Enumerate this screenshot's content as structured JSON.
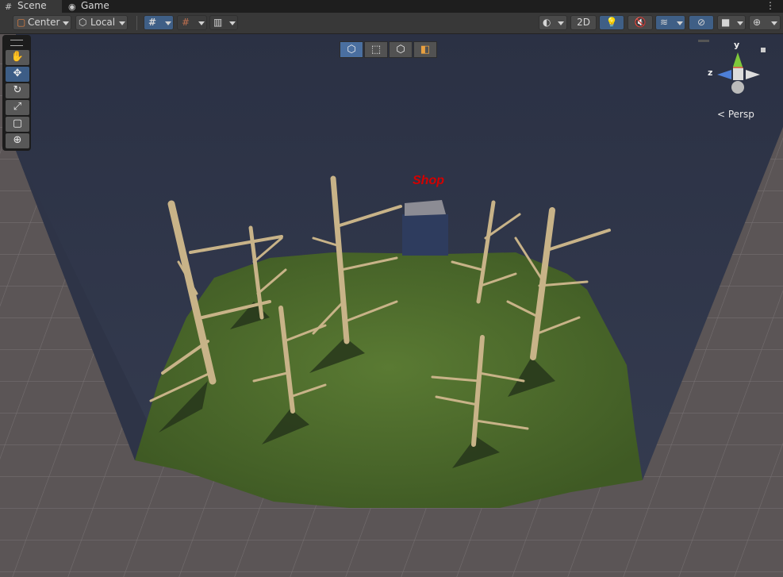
{
  "tabs": [
    {
      "label": "Scene",
      "icon": "grid-icon",
      "active": true
    },
    {
      "label": "Game",
      "icon": "gamepad-icon",
      "active": false
    }
  ],
  "toolbar": {
    "pivot_mode": "Center",
    "pivot_rotation": "Local",
    "mode_2d": "2D"
  },
  "tools": [
    "hand-tool",
    "move-tool",
    "rotate-tool",
    "scale-tool",
    "rect-tool",
    "transform-tool"
  ],
  "selected_tool": "move-tool",
  "view_modes": [
    "cube-icon",
    "rect-icon",
    "box-icon",
    "box-shaded-icon"
  ],
  "gizmo": {
    "axis_y": "y",
    "axis_z": "z",
    "projection": "< Persp"
  },
  "scene": {
    "shop_label": "Shop"
  },
  "colors": {
    "ground": "#4f6b2e",
    "wall": "#3a4256",
    "tree": "#c8b388",
    "shop_text": "#d40000",
    "selected": "#3d5d86"
  }
}
